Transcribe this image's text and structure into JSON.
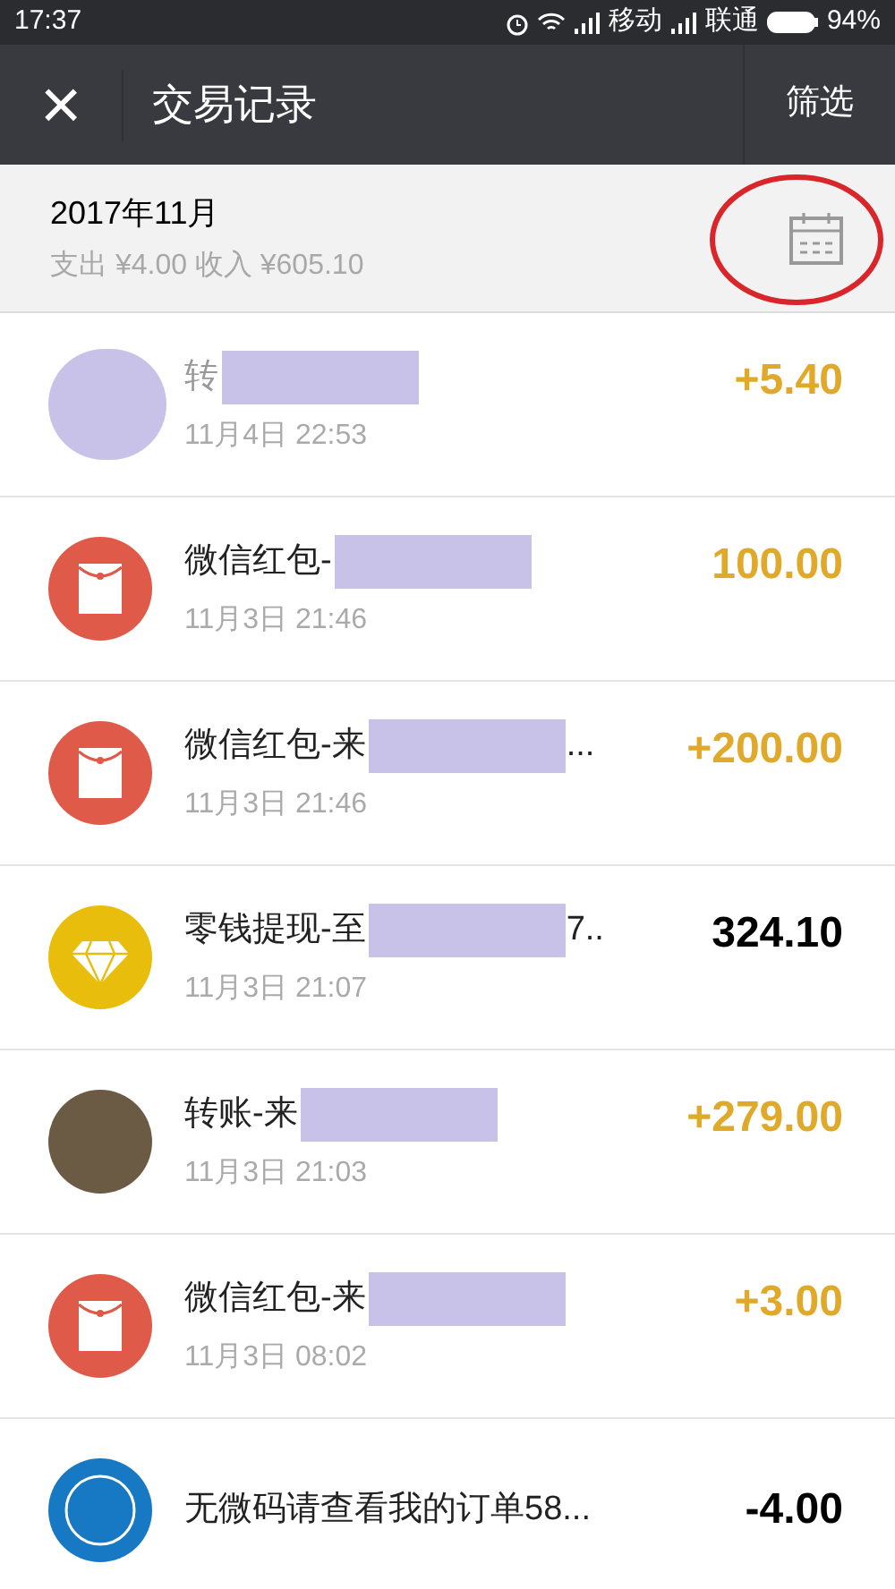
{
  "status_bar": {
    "time": "17:37",
    "carrier_1": "移动",
    "carrier_2": "联通",
    "battery": "94%"
  },
  "nav": {
    "close": "×",
    "title": "交易记录",
    "action": "筛选"
  },
  "month": {
    "title": "2017年11月",
    "summary": "支出 ¥4.00 收入 ¥605.10"
  },
  "transactions": [
    {
      "kind": "redacted",
      "title": "转",
      "redacted": true,
      "time": "11月4日 22:53",
      "amount": "+5.40",
      "highlighted": true
    },
    {
      "kind": "red-packet",
      "title": "微信红包-",
      "redacted": true,
      "time": "11月3日 21:46",
      "amount": "100.00",
      "highlighted": true
    },
    {
      "kind": "red-packet",
      "title": "微信红包-来",
      "redacted": true,
      "trail": "...",
      "time": "11月3日 21:46",
      "amount": "+200.00",
      "highlighted": true
    },
    {
      "kind": "diamond",
      "title": "零钱提现-至",
      "redacted": true,
      "trail": "7..",
      "time": "11月3日 21:07",
      "amount": "324.10",
      "highlighted": false
    },
    {
      "kind": "photo",
      "title": "转账-来",
      "redacted": true,
      "time": "11月3日 21:03",
      "amount": "+279.00",
      "highlighted": true
    },
    {
      "kind": "red-packet",
      "title": "微信红包-来",
      "redacted": true,
      "time": "11月3日 08:02",
      "amount": "+3.00",
      "highlighted": true
    },
    {
      "kind": "logo",
      "title": "无微码请查看我的订单58...",
      "redacted": false,
      "amount": "-4.00",
      "highlighted": false
    }
  ]
}
